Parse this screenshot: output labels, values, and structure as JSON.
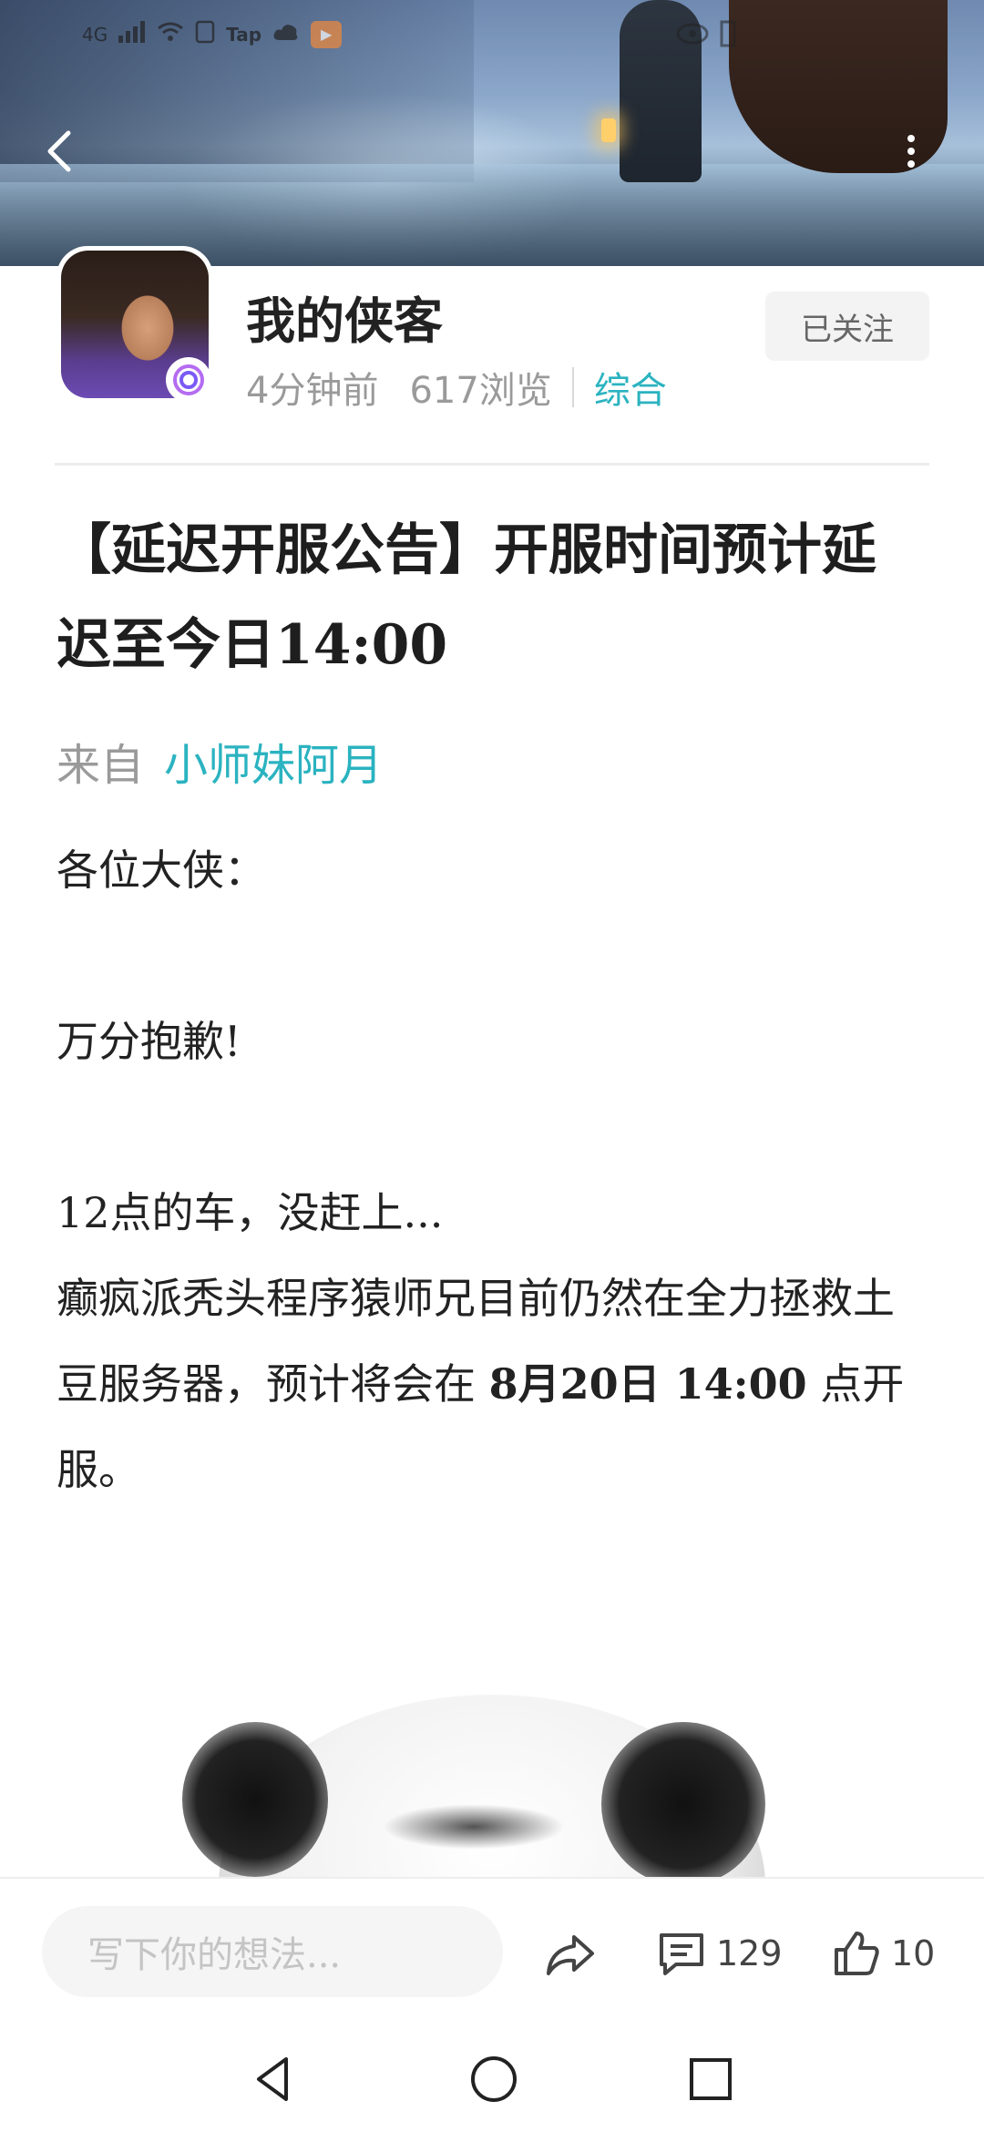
{
  "status_bar": {
    "signal": "4G",
    "tap_label": "Tap"
  },
  "app": {
    "name": "我的侠客",
    "time_ago": "4分钟前",
    "views": "617浏览",
    "category": "综合",
    "follow_label": "已关注"
  },
  "article": {
    "title": "【延迟开服公告】开服时间预计延迟至今日14:00",
    "source_prefix": "来自",
    "author": "小师妹阿月",
    "paragraphs": [
      "各位大侠：",
      "万分抱歉!",
      "12点的车，没赶上...",
      "癫疯派秃头程序猿师兄目前仍然在全力拯救土豆服务器，预计将会在 ",
      "8月20日 14:00",
      " 点开服。"
    ]
  },
  "bottom_bar": {
    "comment_placeholder": "写下你的想法...",
    "comments_count": "129",
    "likes_count": "10"
  },
  "colors": {
    "accent": "#2bb3c0",
    "muted": "#9a9a9a",
    "text": "#222222"
  }
}
